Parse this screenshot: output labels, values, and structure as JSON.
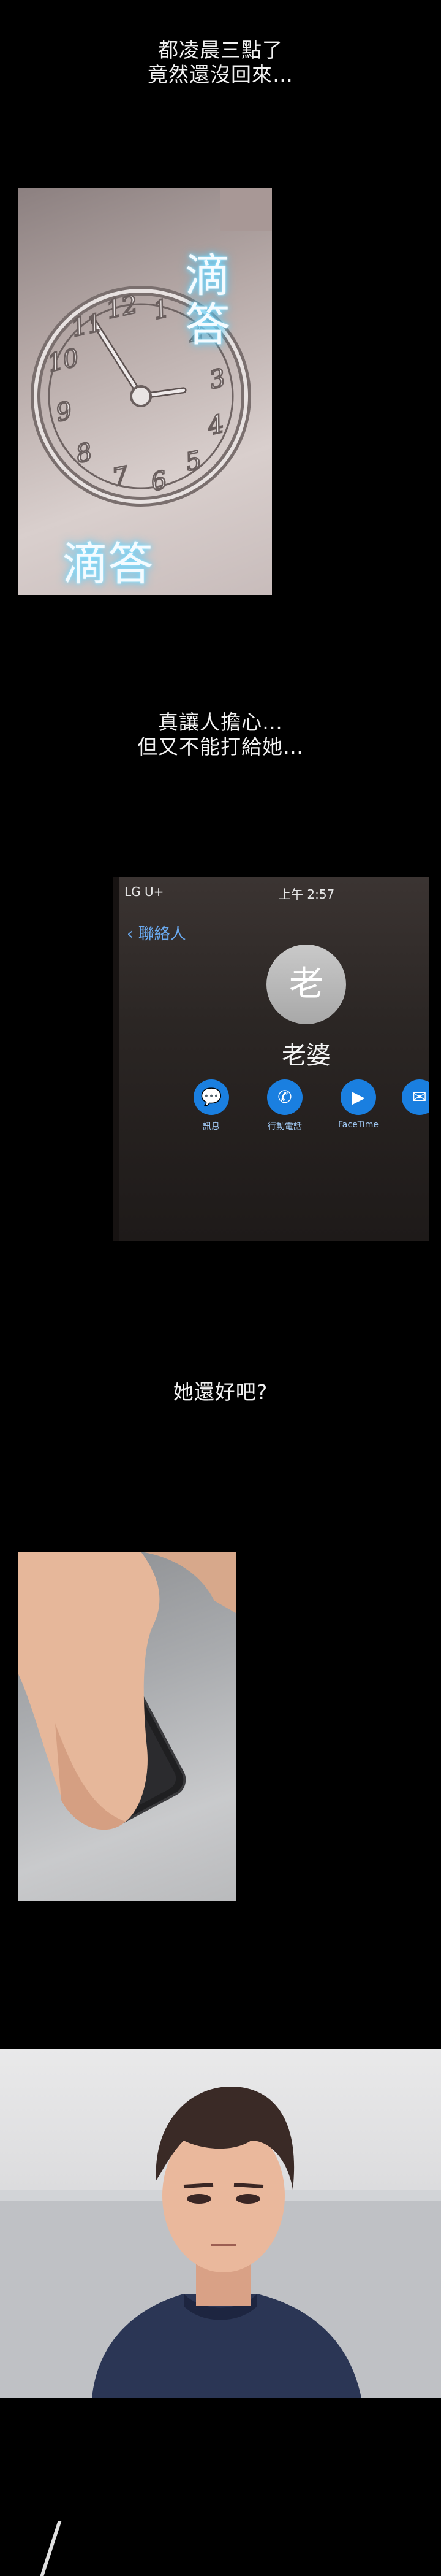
{
  "captions": {
    "c1_line1": "都凌晨三點了",
    "c1_line2": "竟然還沒回來…",
    "c2_line1": "真讓人擔心…",
    "c2_line2": "但又不能打給她…",
    "c3_line1": "她還好吧?"
  },
  "clock_panel": {
    "sfx_top": "滴答",
    "sfx_bottom": "滴答",
    "numerals": [
      "12",
      "1",
      "2",
      "3",
      "4",
      "5",
      "6",
      "7",
      "8",
      "9",
      "10",
      "11"
    ]
  },
  "phone_panel": {
    "carrier": "LG U+",
    "time": "上午 2:57",
    "back_label": "聯絡人",
    "avatar_initial": "老",
    "contact_name": "老婆",
    "actions": [
      {
        "icon": "message-icon",
        "glyph": "💬",
        "label": "訊息"
      },
      {
        "icon": "phone-icon",
        "glyph": "✆",
        "label": "行動電話"
      },
      {
        "icon": "facetime-icon",
        "glyph": "▶",
        "label": "FaceTime"
      },
      {
        "icon": "mail-icon",
        "glyph": "✉",
        "label": ""
      }
    ]
  },
  "colors": {
    "background": "#000000",
    "caption": "#f2f2f2",
    "ios_blue": "#1a7fe0",
    "sfx_glow": "#45c6ff"
  }
}
